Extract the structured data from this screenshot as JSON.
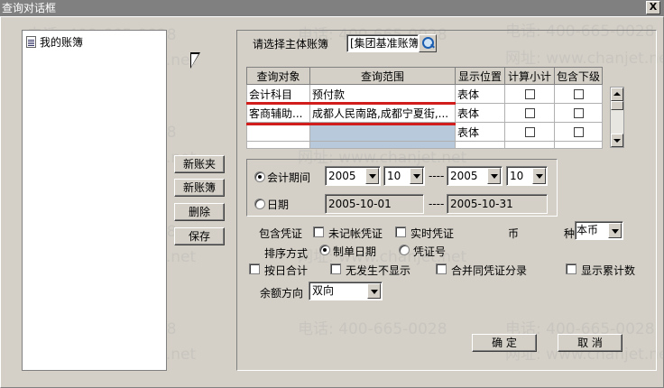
{
  "window": {
    "title": "查询对话框",
    "close_glyph": "X"
  },
  "tree": {
    "items": [
      {
        "label": "我的账簿"
      }
    ]
  },
  "left_buttons": {
    "new_folder": "新账夹",
    "new_book": "新账簿",
    "delete": "删除",
    "save": "保存"
  },
  "main_book": {
    "label": "请选择主体账簿",
    "value": "[集团基准账簿"
  },
  "grid": {
    "headers": [
      "查询对象",
      "查询范围",
      "显示位置",
      "计算小计",
      "包含下级"
    ],
    "rows": [
      {
        "object": "会计科目",
        "range": "预付款",
        "position": "表体",
        "subtotal": false,
        "include_sub": false,
        "selected": false
      },
      {
        "object": "客商辅助...",
        "range": "成都人民南路,成都宁夏街,...",
        "position": "表体",
        "subtotal": false,
        "include_sub": false,
        "selected": false
      },
      {
        "object": "",
        "range": "",
        "position": "表体",
        "subtotal": false,
        "include_sub": false,
        "selected": true
      },
      {
        "object": "",
        "range": "",
        "position": "",
        "subtotal": false,
        "include_sub": false,
        "selected": false
      }
    ]
  },
  "period": {
    "mode_period_label": "会计期间",
    "mode_date_label": "日期",
    "selected_mode": "period",
    "year_from": "2005",
    "month_from": "10",
    "separator": "----",
    "year_to": "2005",
    "month_to": "10",
    "date_from": "2005-10-01",
    "date_to": "2005-10-31"
  },
  "options": {
    "include_voucher_label": "包含凭证",
    "unposted_label": "未记帐凭证",
    "realtime_label": "实时凭证",
    "currency_label_1": "币",
    "currency_label_2": "种",
    "currency_value": "本币",
    "sort_label": "排序方式",
    "sort_by_date_label": "制单日期",
    "sort_by_voucher_label": "凭证号",
    "sort_selected": "date",
    "daily_total_label": "按日合计",
    "hide_empty_label": "无发生不显示",
    "merge_entries_label": "合并同凭证分录",
    "show_cumulative_label": "显示累计数",
    "balance_dir_label": "余额方向",
    "balance_dir_value": "双向"
  },
  "footer": {
    "ok_label": "确 定",
    "cancel_label": "取 消"
  },
  "watermark": {
    "phone": "电话: 400-665-0028",
    "site": "网址: www.chanjet.net"
  },
  "colors": {
    "titlebar": "#808080",
    "dialog_bg": "#d4d0c8",
    "annotation_red": "#d21d1d",
    "selected_cell": "#b7c9da"
  }
}
